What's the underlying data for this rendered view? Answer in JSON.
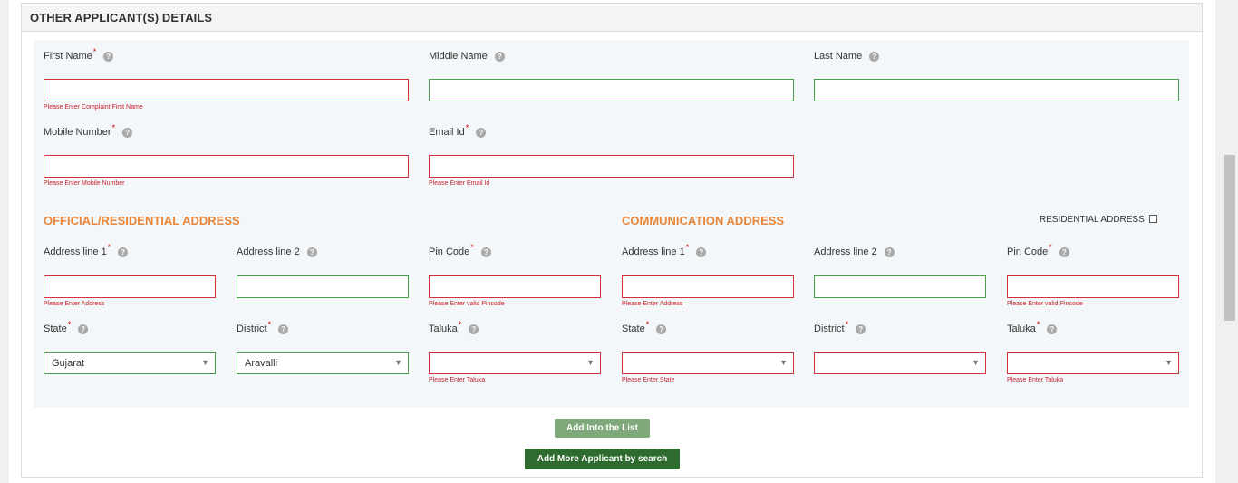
{
  "panel": {
    "title": "OTHER APPLICANT(S) DETAILS"
  },
  "help_glyph": "?",
  "required_mark": "*",
  "fields": {
    "first_name": {
      "label": "First Name",
      "value": "",
      "error": "Please Enter Complaint First Name"
    },
    "middle_name": {
      "label": "Middle Name",
      "value": ""
    },
    "last_name": {
      "label": "Last Name",
      "value": ""
    },
    "mobile_number": {
      "label": "Mobile Number",
      "value": "",
      "error": "Please Enter Mobile Number"
    },
    "email_id": {
      "label": "Email Id",
      "value": "",
      "error": "Please Enter Email Id"
    }
  },
  "official_address": {
    "title": "OFFICIAL/RESIDENTIAL ADDRESS",
    "address1": {
      "label": "Address line 1",
      "value": "",
      "error": "Please Enter Address"
    },
    "address2": {
      "label": "Address line 2",
      "value": ""
    },
    "pincode": {
      "label": "Pin Code",
      "value": "",
      "error": "Please Enter valid Pincode"
    },
    "state": {
      "label": "State",
      "selected": "Gujarat"
    },
    "district": {
      "label": "District",
      "selected": "Aravalli"
    },
    "taluka": {
      "label": "Taluka",
      "selected": "",
      "error": "Please Enter Taluka"
    }
  },
  "communication_address": {
    "title": "COMMUNICATION ADDRESS",
    "residential_checkbox_label": "RESIDENTIAL ADDRESS",
    "residential_checked": false,
    "address1": {
      "label": "Address line 1",
      "value": "",
      "error": "Please Enter Address"
    },
    "address2": {
      "label": "Address line 2",
      "value": ""
    },
    "pincode": {
      "label": "Pin Code",
      "value": "",
      "error": "Please Enter valid Pincode"
    },
    "state": {
      "label": "State",
      "selected": "",
      "error": "Please Enter State"
    },
    "district": {
      "label": "District",
      "selected": ""
    },
    "taluka": {
      "label": "Taluka",
      "selected": "",
      "error": "Please Enter Taluka"
    }
  },
  "buttons": {
    "add_into_list": "Add Into the List",
    "add_more_by_search": "Add More Applicant by search"
  },
  "colors": {
    "section_title": "#e8863a",
    "error": "#d0313b",
    "valid_border": "#4a9d4a",
    "primary_button": "#2e6b2e",
    "secondary_button": "#7fa97a"
  }
}
